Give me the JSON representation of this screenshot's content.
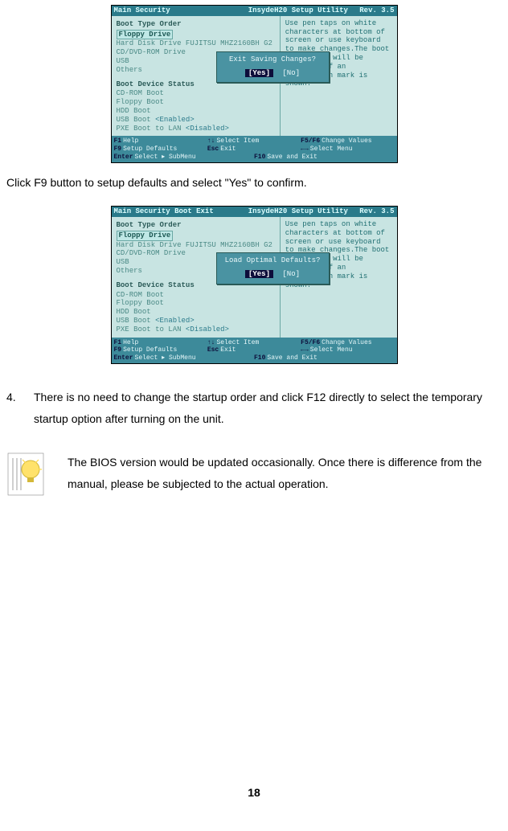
{
  "bios1": {
    "titlebar": {
      "menu": "Main  Security",
      "center": "InsydeH20 Setup Utility",
      "rev": "Rev. 3.5"
    },
    "section1": "Boot Type Order",
    "highlighted": "Floppy Drive",
    "items1": [
      "Hard Disk Drive  FUJITSU MHZ2160BH G2",
      "CD/DVD-ROM Drive",
      "USB",
      "Others"
    ],
    "section2": "Boot Device Status",
    "items2": [
      {
        "name": "CD-ROM Boot",
        "val": ""
      },
      {
        "name": "Floppy Boot",
        "val": ""
      },
      {
        "name": "HDD Boot",
        "val": ""
      },
      {
        "name": "USB Boot",
        "val": "<Enabled>"
      },
      {
        "name": "PXE Boot to LAN",
        "val": "<Disabled>"
      }
    ],
    "help": "Use pen taps on white characters at bottom of screen or use keyboard to make changes.The boot capability will be disabled if an exclamation mark is shown.",
    "popup": {
      "q": "Exit Saving Changes?",
      "yes": "[Yes]",
      "no": "[No]"
    },
    "footer": {
      "f1": "Help",
      "f2": "Select Item",
      "f3": "Change Values",
      "f4": "Setup Defaults",
      "f5": "Exit",
      "f6": "Select Menu",
      "f7": "Select ▸ SubMenu",
      "f8": "Save and Exit",
      "k1": "F1",
      "k2": "↑↓",
      "k3": "F5/F6",
      "k4": "F9",
      "k5": "Esc",
      "k6": "←→",
      "k7": "Enter",
      "k8": "F10"
    }
  },
  "caption1": "Click F9 button to setup defaults and select \"Yes\" to confirm.",
  "bios2": {
    "titlebar": {
      "menu": "Main  Security  Boot  Exit",
      "center": "InsydeH20 Setup Utility",
      "rev": "Rev. 3.5"
    },
    "section1": "Boot Type Order",
    "highlighted": "Floppy Drive",
    "items1": [
      "Hard Disk Drive  FUJITSU MHZ2160BH G2",
      "CD/DVD-ROM Drive",
      "USB",
      "Others"
    ],
    "section2": "Boot Device Status",
    "items2": [
      {
        "name": "CD-ROM Boot",
        "val": ""
      },
      {
        "name": "Floppy Boot",
        "val": ""
      },
      {
        "name": "HDD Boot",
        "val": ""
      },
      {
        "name": "USB Boot",
        "val": "<Enabled>"
      },
      {
        "name": "PXE Boot to LAN",
        "val": "<Disabled>"
      }
    ],
    "help": "Use pen taps on white characters at bottom of screen or use keyboard to make changes.The boot capability will be disabled if an exclamation mark is shown.",
    "popup": {
      "q": "Load Optimal Defaults?",
      "yes": "[Yes]",
      "no": "[No]"
    },
    "footer": {
      "f1": "Help",
      "f2": "Select Item",
      "f3": "Change Values",
      "f4": "Setup Defaults",
      "f5": "Exit",
      "f6": "Select Menu",
      "f7": "Select ▸ SubMenu",
      "f8": "Save and Exit",
      "k1": "F1",
      "k2": "↑↓",
      "k3": "F5/F6",
      "k4": "F9",
      "k5": "Esc",
      "k6": "←→",
      "k7": "Enter",
      "k8": "F10"
    }
  },
  "step4": {
    "num": "4.",
    "text": "There is no need to change the startup order and click F12 directly to select the temporary startup option after turning on the unit."
  },
  "tip": "The BIOS version would be updated occasionally. Once there is difference from the manual, please be subjected to the actual operation.",
  "page_number": "18"
}
